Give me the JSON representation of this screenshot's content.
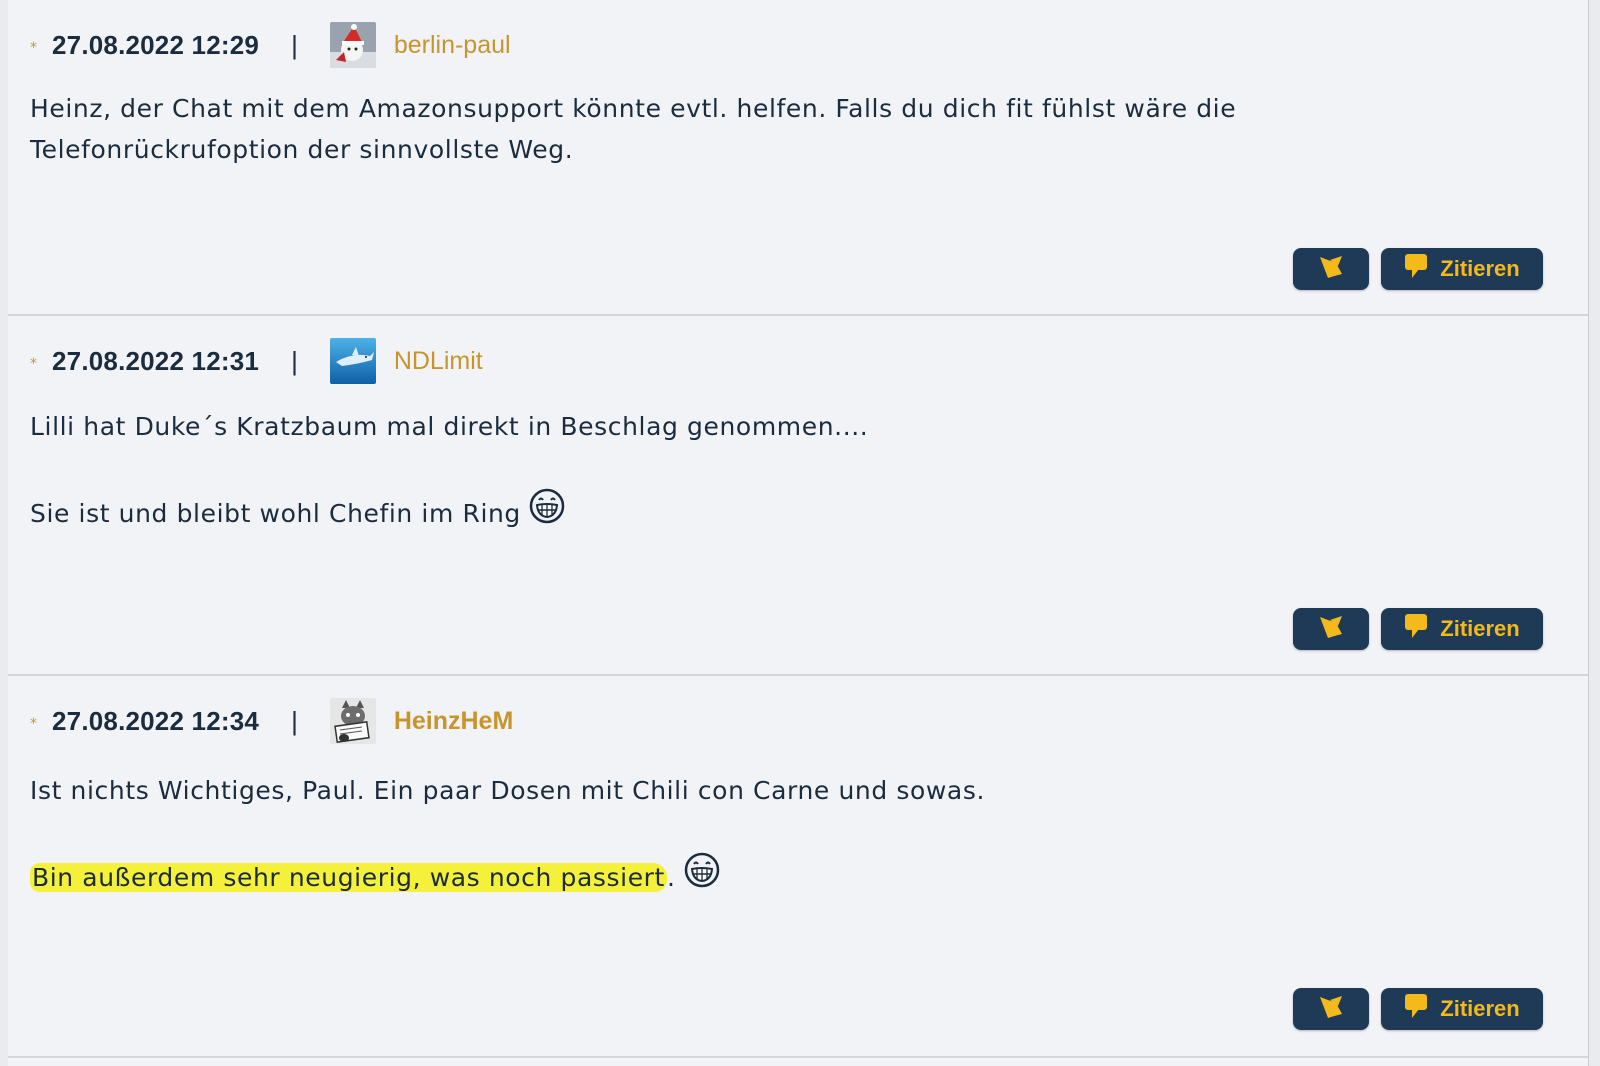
{
  "colors": {
    "accent": "#c8942d",
    "button_bg": "#1e3a57",
    "button_fg": "#f4b91a",
    "text": "#1b2c3e",
    "highlight": "#f5f03a"
  },
  "posts": [
    {
      "star": "*",
      "timestamp": "27.08.2022 12:29",
      "separator": "|",
      "author": "berlin-paul",
      "avatar_icon": "santa-snowman-avatar",
      "lines": [
        "Heinz, der Chat mit dem Amazonsupport könnte evtl. helfen. Falls du dich fit fühlst wäre die",
        "Telefonrückrufoption der sinnvollste Weg."
      ],
      "quote_label": "Zitieren"
    },
    {
      "star": "*",
      "timestamp": "27.08.2022 12:31",
      "separator": "|",
      "author": "NDLimit",
      "avatar_icon": "shark-avatar",
      "lines": [
        "Lilli hat Duke´s Kratzbaum mal direkt in Beschlag genommen....",
        "Sie ist und bleibt wohl Chefin im Ring"
      ],
      "quote_label": "Zitieren"
    },
    {
      "star": "*",
      "timestamp": "27.08.2022 12:34",
      "separator": "|",
      "author": "HeinzHeM",
      "avatar_icon": "cat-avatar",
      "lines": [
        "Ist nichts Wichtiges, Paul. Ein paar Dosen mit Chili con Carne und sowas.",
        "Bin außerdem sehr neugierig, was noch passiert",
        "."
      ],
      "quote_label": "Zitieren"
    }
  ]
}
